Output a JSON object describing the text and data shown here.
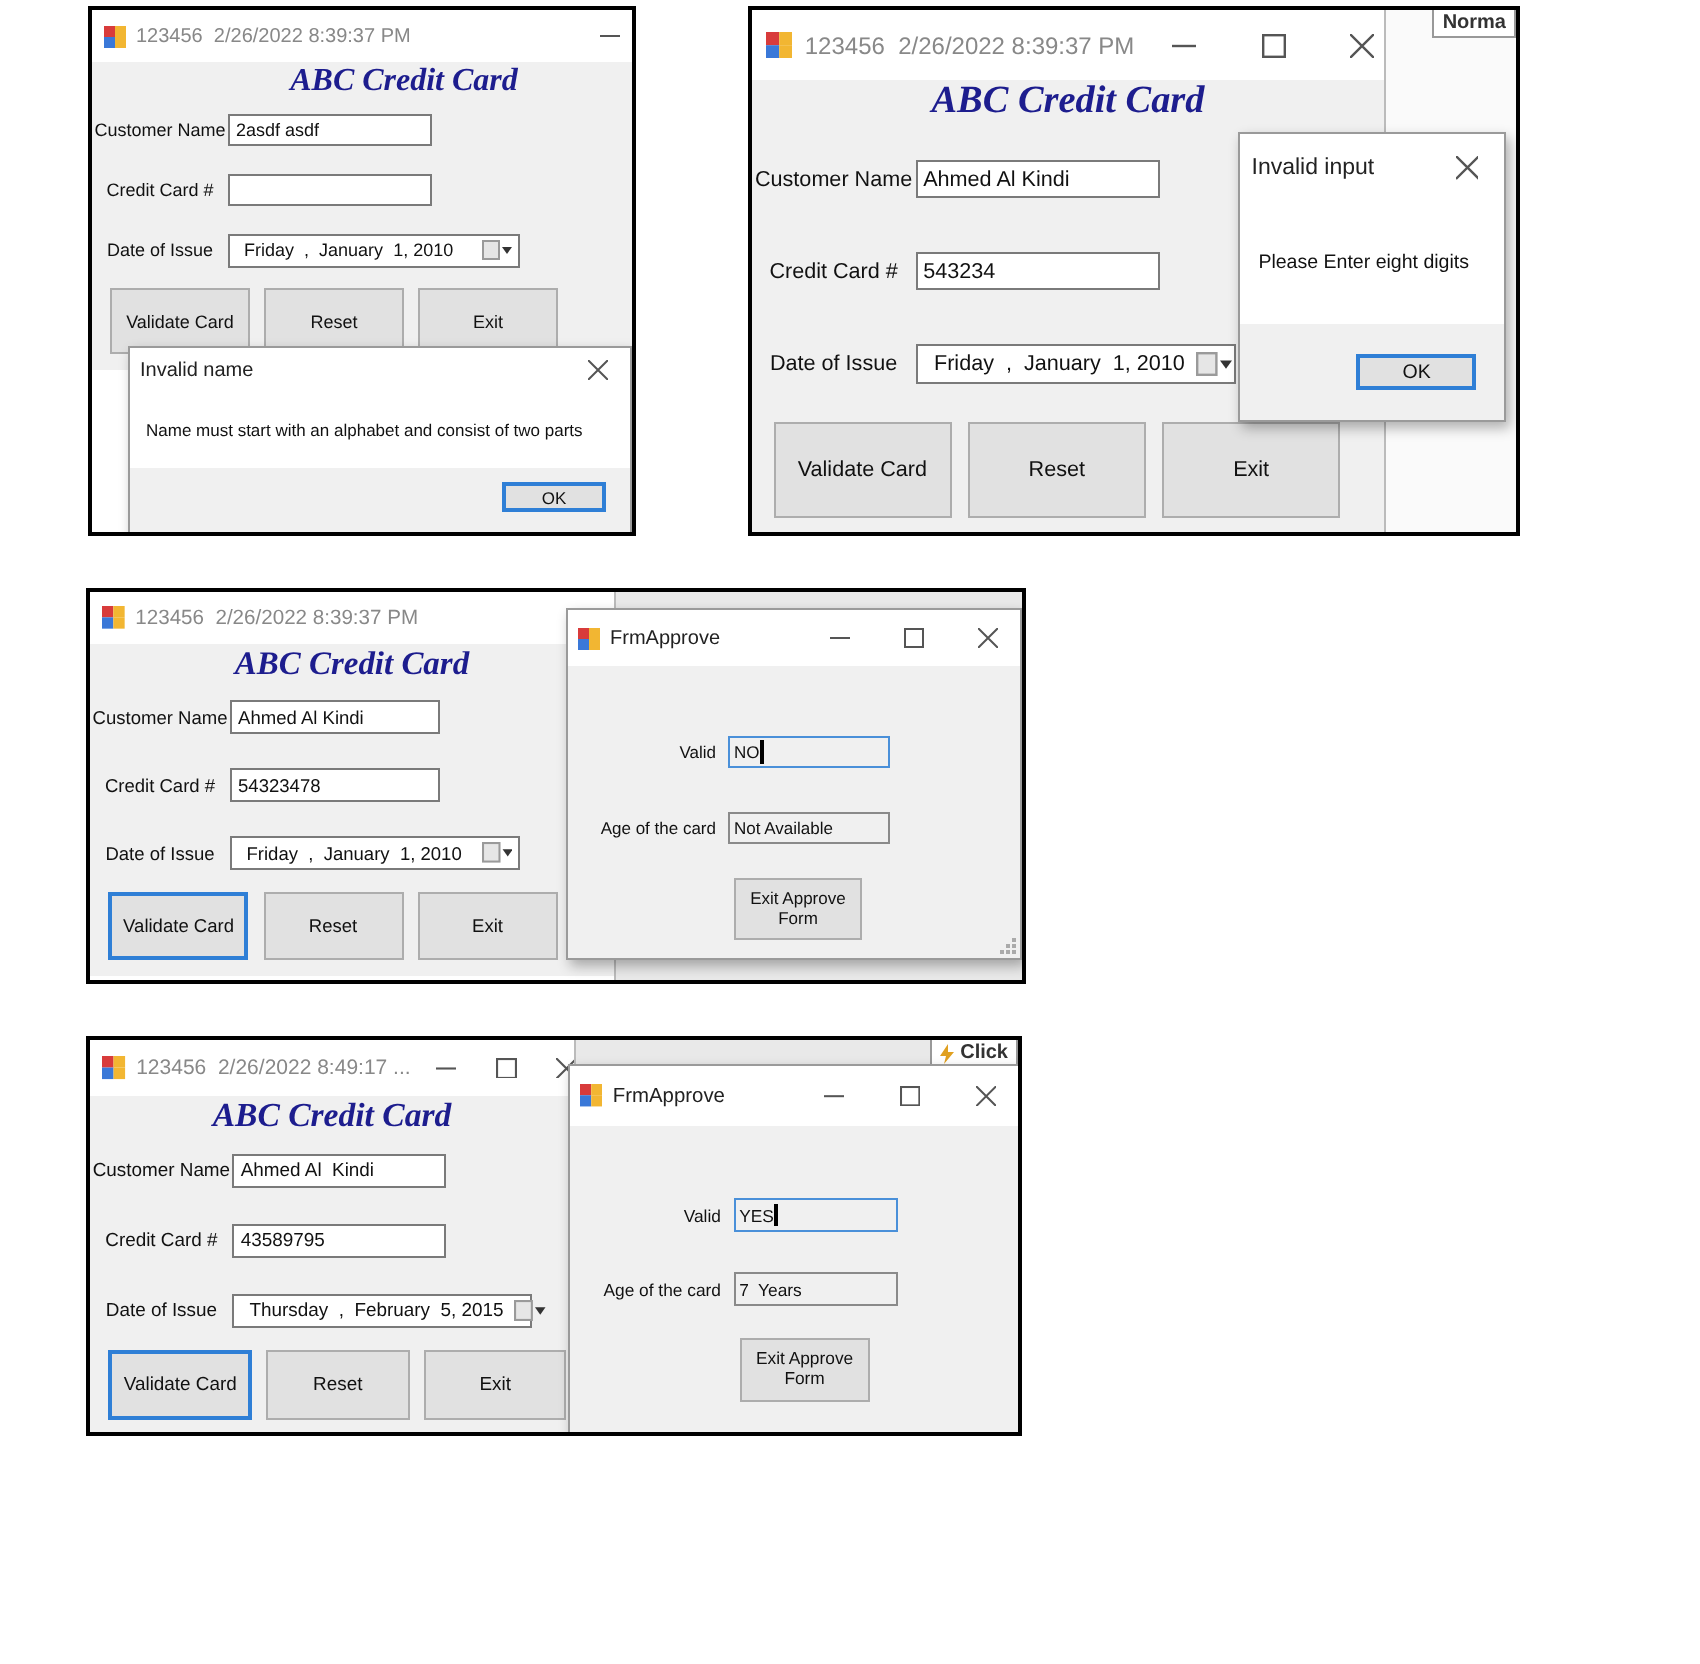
{
  "screenshots": [
    {
      "form": {
        "title": "123456  2/26/2022 8:39:37 PM",
        "heading": "ABC Credit Card",
        "fields": [
          {
            "label": "Customer Name",
            "value": "2asdf asdf"
          },
          {
            "label": "Credit Card #"
          }
        ],
        "date": {
          "label": "Date of Issue",
          "parts": [
            "Friday",
            ",",
            "January",
            "1, 2010"
          ]
        },
        "buttons": [
          {
            "label": "Validate Card",
            "focused": false
          },
          {
            "label": "Reset",
            "focused": false
          },
          {
            "label": "Exit",
            "focused": false
          }
        ]
      },
      "dialog": {
        "kind": "message",
        "title": "Invalid name",
        "message": "Name must start with an alphabet and consist of two parts",
        "button": {
          "label": "OK",
          "focused": true
        }
      }
    },
    {
      "form": {
        "title": "123456  2/26/2022 8:39:37 PM",
        "heading": "ABC Credit Card",
        "fields": [
          {
            "label": "Customer Name",
            "value": "Ahmed Al Kindi"
          },
          {
            "label": "Credit Card #",
            "value": "543234"
          }
        ],
        "date": {
          "label": "Date of Issue",
          "parts": [
            "Friday",
            ",",
            "January",
            "1, 2010"
          ]
        },
        "buttons": [
          {
            "label": "Validate Card",
            "focused": false
          },
          {
            "label": "Reset",
            "focused": false
          },
          {
            "label": "Exit",
            "focused": false
          }
        ]
      },
      "background_text": "Norma",
      "dialog": {
        "kind": "message",
        "title": "Invalid input",
        "message": "Please Enter eight digits",
        "button": {
          "label": "OK",
          "focused": true
        }
      }
    },
    {
      "form": {
        "title": "123456  2/26/2022 8:39:37 PM",
        "heading": "ABC Credit Card",
        "fields": [
          {
            "label": "Customer Name",
            "value": "Ahmed Al Kindi"
          },
          {
            "label": "Credit Card #",
            "value": "54323478"
          }
        ],
        "date": {
          "label": "Date of Issue",
          "parts": [
            "Friday",
            ",",
            "January",
            "1, 2010"
          ]
        },
        "buttons": [
          {
            "label": "Validate Card",
            "focused": true
          },
          {
            "label": "Reset",
            "focused": false
          },
          {
            "label": "Exit",
            "focused": false
          }
        ]
      },
      "dialog": {
        "kind": "approve",
        "title": "FrmApprove",
        "fields": [
          {
            "label": "Valid",
            "value": "NO",
            "focused": true
          },
          {
            "label": "Age of the card",
            "value": "Not Available",
            "focused": false
          }
        ],
        "button": {
          "label": "Exit Approve Form",
          "focused": false
        },
        "resize_grip": true
      }
    },
    {
      "form": {
        "title": "123456  2/26/2022 8:49:17 ...",
        "heading": "ABC Credit Card",
        "fields": [
          {
            "label": "Customer Name",
            "value": "Ahmed Al  Kindi"
          },
          {
            "label": "Credit Card #",
            "value": "43589795"
          }
        ],
        "date": {
          "label": "Date of Issue",
          "parts": [
            "Thursday",
            ",",
            "February",
            "5, 2015"
          ]
        },
        "buttons": [
          {
            "label": "Validate Card",
            "focused": true
          },
          {
            "label": "Reset",
            "focused": false
          },
          {
            "label": "Exit",
            "focused": false
          }
        ]
      },
      "background_text": "Click",
      "dialog": {
        "kind": "approve",
        "title": "FrmApprove",
        "fields": [
          {
            "label": "Valid",
            "value": "YES",
            "focused": true
          },
          {
            "label": "Age of the card",
            "value": "7  Years",
            "focused": false
          }
        ],
        "button": {
          "label": "Exit Approve Form",
          "focused": false
        }
      }
    }
  ]
}
